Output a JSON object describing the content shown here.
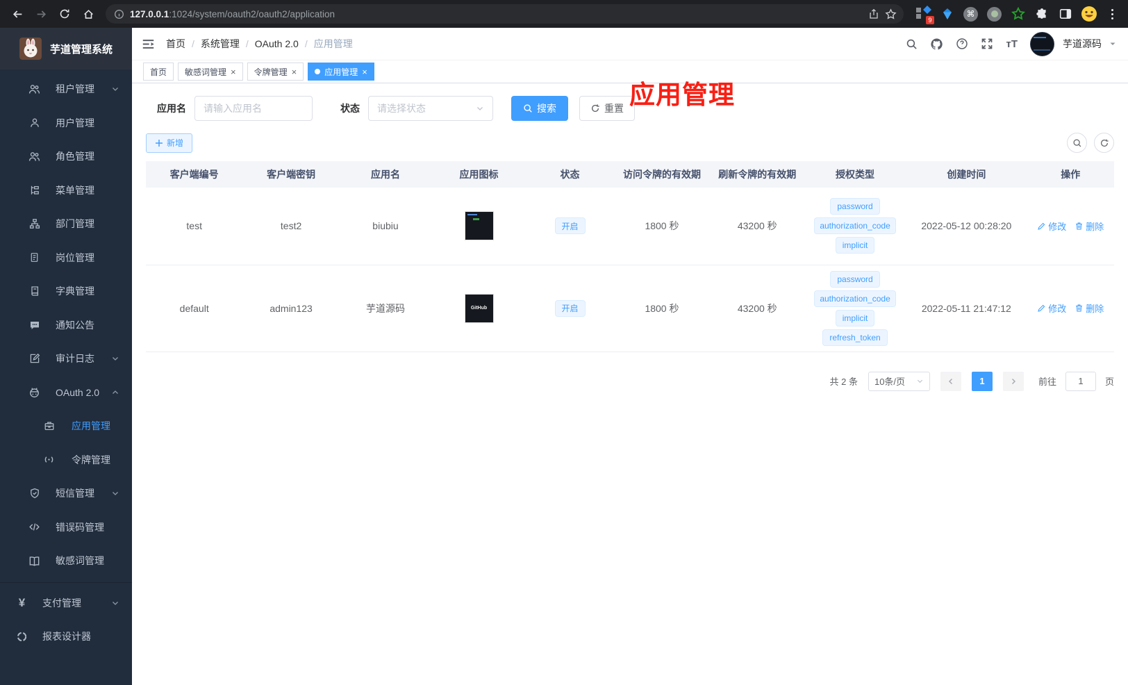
{
  "theme": {
    "accent": "#409eff",
    "annotation_red": "#f81f14",
    "sidebar_bg": "#212c3c",
    "tag_bg": "#ecf5ff"
  },
  "browser": {
    "url_host": "127.0.0.1",
    "url_path": ":1024/system/oauth2/oauth2/application",
    "extension_badge": "9"
  },
  "sidebar": {
    "logo_title": "芋道管理系统",
    "items": [
      {
        "id": "tenant",
        "label": "租户管理",
        "icon": "users",
        "arrow": "down"
      },
      {
        "id": "user",
        "label": "用户管理",
        "icon": "user"
      },
      {
        "id": "role",
        "label": "角色管理",
        "icon": "users"
      },
      {
        "id": "menu",
        "label": "菜单管理",
        "icon": "tree"
      },
      {
        "id": "dept",
        "label": "部门管理",
        "icon": "org"
      },
      {
        "id": "post",
        "label": "岗位管理",
        "icon": "badge"
      },
      {
        "id": "dict",
        "label": "字典管理",
        "icon": "book"
      },
      {
        "id": "notice",
        "label": "通知公告",
        "icon": "comment"
      },
      {
        "id": "audit",
        "label": "审计日志",
        "icon": "edit",
        "arrow": "down"
      },
      {
        "id": "oauth",
        "label": "OAuth 2.0",
        "icon": "robot",
        "arrow": "up"
      },
      {
        "id": "oauth-app",
        "label": "应用管理",
        "icon": "briefcase",
        "sub": true,
        "active": true
      },
      {
        "id": "oauth-token",
        "label": "令牌管理",
        "icon": "signal",
        "sub": true
      },
      {
        "id": "sms",
        "label": "短信管理",
        "icon": "shield",
        "arrow": "down"
      },
      {
        "id": "errcode",
        "label": "错误码管理",
        "icon": "code"
      },
      {
        "id": "sensitive",
        "label": "敏感词管理",
        "icon": "openbook"
      },
      {
        "divider": true
      },
      {
        "id": "pay",
        "label": "支付管理",
        "icon": "yen",
        "arrow": "down",
        "root": true
      },
      {
        "id": "report",
        "label": "报表设计器",
        "icon": "report",
        "root": true
      }
    ]
  },
  "header": {
    "breadcrumbs": [
      "首页",
      "系统管理",
      "OAuth 2.0",
      "应用管理"
    ],
    "username": "芋道源码"
  },
  "tabs": [
    {
      "label": "首页",
      "closable": false,
      "active": false
    },
    {
      "label": "敏感词管理",
      "closable": true,
      "active": false
    },
    {
      "label": "令牌管理",
      "closable": true,
      "active": false
    },
    {
      "label": "应用管理",
      "closable": true,
      "active": true
    }
  ],
  "annotation": {
    "text": "应用管理"
  },
  "filters": {
    "name_label": "应用名",
    "name_placeholder": "请输入应用名",
    "status_label": "状态",
    "status_placeholder": "请选择状态",
    "search_label": "搜索",
    "reset_label": "重置"
  },
  "toolbar": {
    "add_label": "新增"
  },
  "table": {
    "columns": [
      {
        "id": "client_id",
        "label": "客户端编号",
        "width": "10%"
      },
      {
        "id": "secret",
        "label": "客户端密钥",
        "width": "10%"
      },
      {
        "id": "app_name",
        "label": "应用名",
        "width": "9.5%"
      },
      {
        "id": "app_icon",
        "label": "应用图标",
        "width": "9.8%"
      },
      {
        "id": "status",
        "label": "状态",
        "width": "9%"
      },
      {
        "id": "access_ttl",
        "label": "访问令牌的有效期",
        "width": "10%"
      },
      {
        "id": "refresh_ttl",
        "label": "刷新令牌的有效期",
        "width": "9.7%"
      },
      {
        "id": "grants",
        "label": "授权类型",
        "width": "10.5%"
      },
      {
        "id": "created_at",
        "label": "创建时间",
        "width": "12.5%"
      },
      {
        "id": "actions",
        "label": "操作",
        "width": "9%"
      }
    ],
    "rows": [
      {
        "client_id": "test",
        "secret": "test2",
        "app_name": "biubiu",
        "icon": "screenshot",
        "icon_text": "",
        "status": "开启",
        "access_ttl": "1800 秒",
        "refresh_ttl": "43200 秒",
        "grants": [
          "password",
          "authorization_code",
          "implicit"
        ],
        "created_at": "2022-05-12 00:28:20"
      },
      {
        "client_id": "default",
        "secret": "admin123",
        "app_name": "芋道源码",
        "icon": "github",
        "icon_text": "GitHub",
        "status": "开启",
        "access_ttl": "1800 秒",
        "refresh_ttl": "43200 秒",
        "grants": [
          "password",
          "authorization_code",
          "implicit",
          "refresh_token"
        ],
        "created_at": "2022-05-11 21:47:12"
      }
    ],
    "actions": {
      "edit": "修改",
      "delete": "删除"
    }
  },
  "pagination": {
    "total_label": "共 2 条",
    "page_size": "10条/页",
    "current_page": "1",
    "goto_label": "前往",
    "goto_value": "1",
    "page_unit": "页"
  }
}
